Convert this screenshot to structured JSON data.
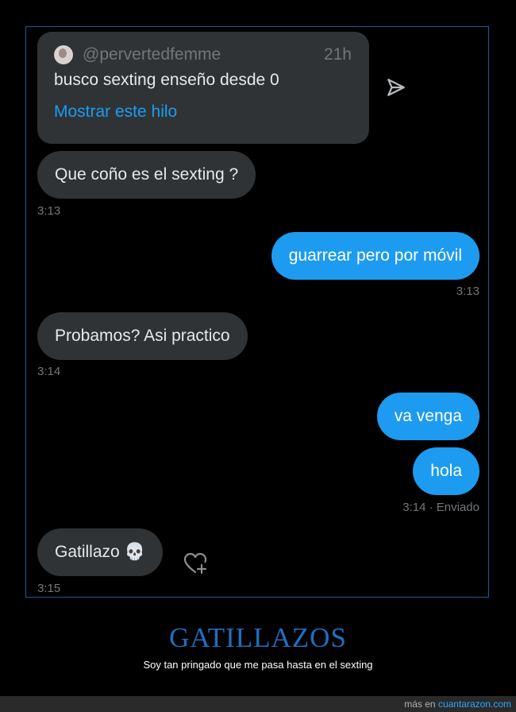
{
  "quoted_tweet": {
    "handle": "@pervertedfemme",
    "time": "21h",
    "text": "busco sexting enseño desde 0",
    "thread_link": "Mostrar este hilo"
  },
  "messages": [
    {
      "text": "Que coño es el sexting ?",
      "time": "3:13",
      "direction": "incoming"
    },
    {
      "text": "guarrear pero por móvil",
      "time": "3:13",
      "direction": "outgoing"
    },
    {
      "text": "Probamos? Asi practico",
      "time": "3:14",
      "direction": "incoming"
    },
    {
      "text": "va venga",
      "direction": "outgoing"
    },
    {
      "text": "hola",
      "time": "3:14 · Enviado",
      "direction": "outgoing"
    },
    {
      "text": "Gatillazo 💀",
      "time": "3:15",
      "direction": "incoming"
    }
  ],
  "caption": {
    "title": "GATILLAZOS",
    "subtitle": "Soy tan pringado que me pasa hasta en el sexting"
  },
  "footer": {
    "prefix": "más en",
    "site": "cuantarazon.com"
  },
  "colors": {
    "accent": "#1d9bf0",
    "incoming_bubble": "#2f3336",
    "title": "#1f6fbf"
  }
}
